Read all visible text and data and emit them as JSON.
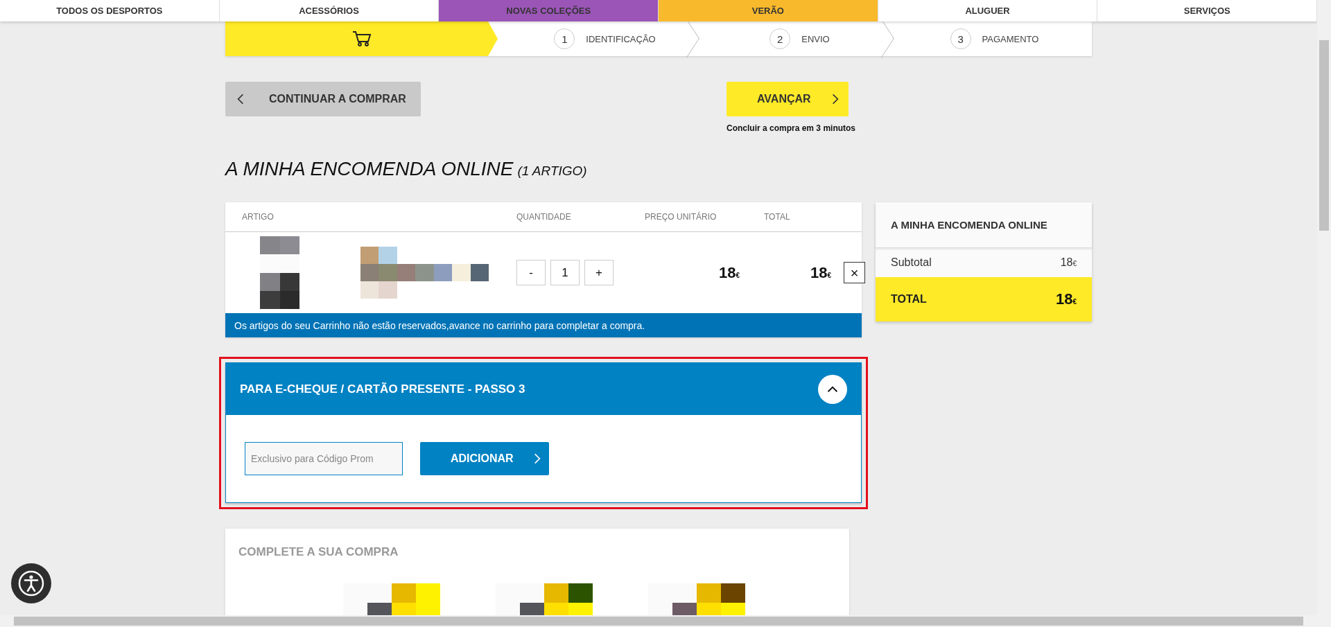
{
  "nav": [
    {
      "label": "TODOS OS DESPORTOS",
      "color": "#ffffff"
    },
    {
      "label": "ACESSÓRIOS",
      "color": "#ffffff"
    },
    {
      "label": "NOVAS COLEÇÕES",
      "color": "#9b55b7"
    },
    {
      "label": "VERÃO",
      "color": "#f8b92c"
    },
    {
      "label": "ALUGUER",
      "color": "#ffffff"
    },
    {
      "label": "SERVIÇOS",
      "color": "#ffffff"
    }
  ],
  "checkout_steps": [
    {
      "kind": "cart",
      "selected": true
    },
    {
      "kind": "numbered",
      "number": "1",
      "label": "IDENTIFICAÇÃO",
      "selected": false
    },
    {
      "kind": "numbered",
      "number": "2",
      "label": "ENVIO",
      "selected": false
    },
    {
      "kind": "numbered",
      "number": "3",
      "label": "PAGAMENTO",
      "selected": false
    }
  ],
  "actions": {
    "back": "CONTINUAR A COMPRAR",
    "next": "AVANÇAR",
    "next_note": "Concluir a compra em 3 minutos"
  },
  "order": {
    "title": "A MINHA ENCOMENDA ONLINE",
    "count": "(1 ARTIGO)",
    "columns": [
      "ARTIGO",
      "QUANTIDADE",
      "PREÇO UNITÁRIO",
      "TOTAL"
    ],
    "rows": [
      {
        "decrement": "-",
        "quantity": "1",
        "increment": "+",
        "unit_price": {
          "amount": "18",
          "currency": "€"
        },
        "total": {
          "amount": "18",
          "currency": "€"
        },
        "remove": "×"
      }
    ],
    "notice": "Os artigos do seu Carrinho não estão reservados,avance no carrinho para completar a compra."
  },
  "summary": {
    "title": "A MINHA ENCOMENDA ONLINE",
    "rows": [
      {
        "kind": "subtotal",
        "label": "Subtotal",
        "amount": "18",
        "currency": "€"
      },
      {
        "kind": "total",
        "label": "TOTAL",
        "amount": "18",
        "currency": "€"
      }
    ]
  },
  "promo": {
    "title": "PARA E-CHEQUE / CARTÃO PRESENTE - PASSO 3",
    "expanded": true,
    "placeholder": "Exclusivo para Código Prom",
    "button": "ADICIONAR"
  },
  "recommendations": {
    "title": "COMPLETE A SUA COMPRA"
  }
}
